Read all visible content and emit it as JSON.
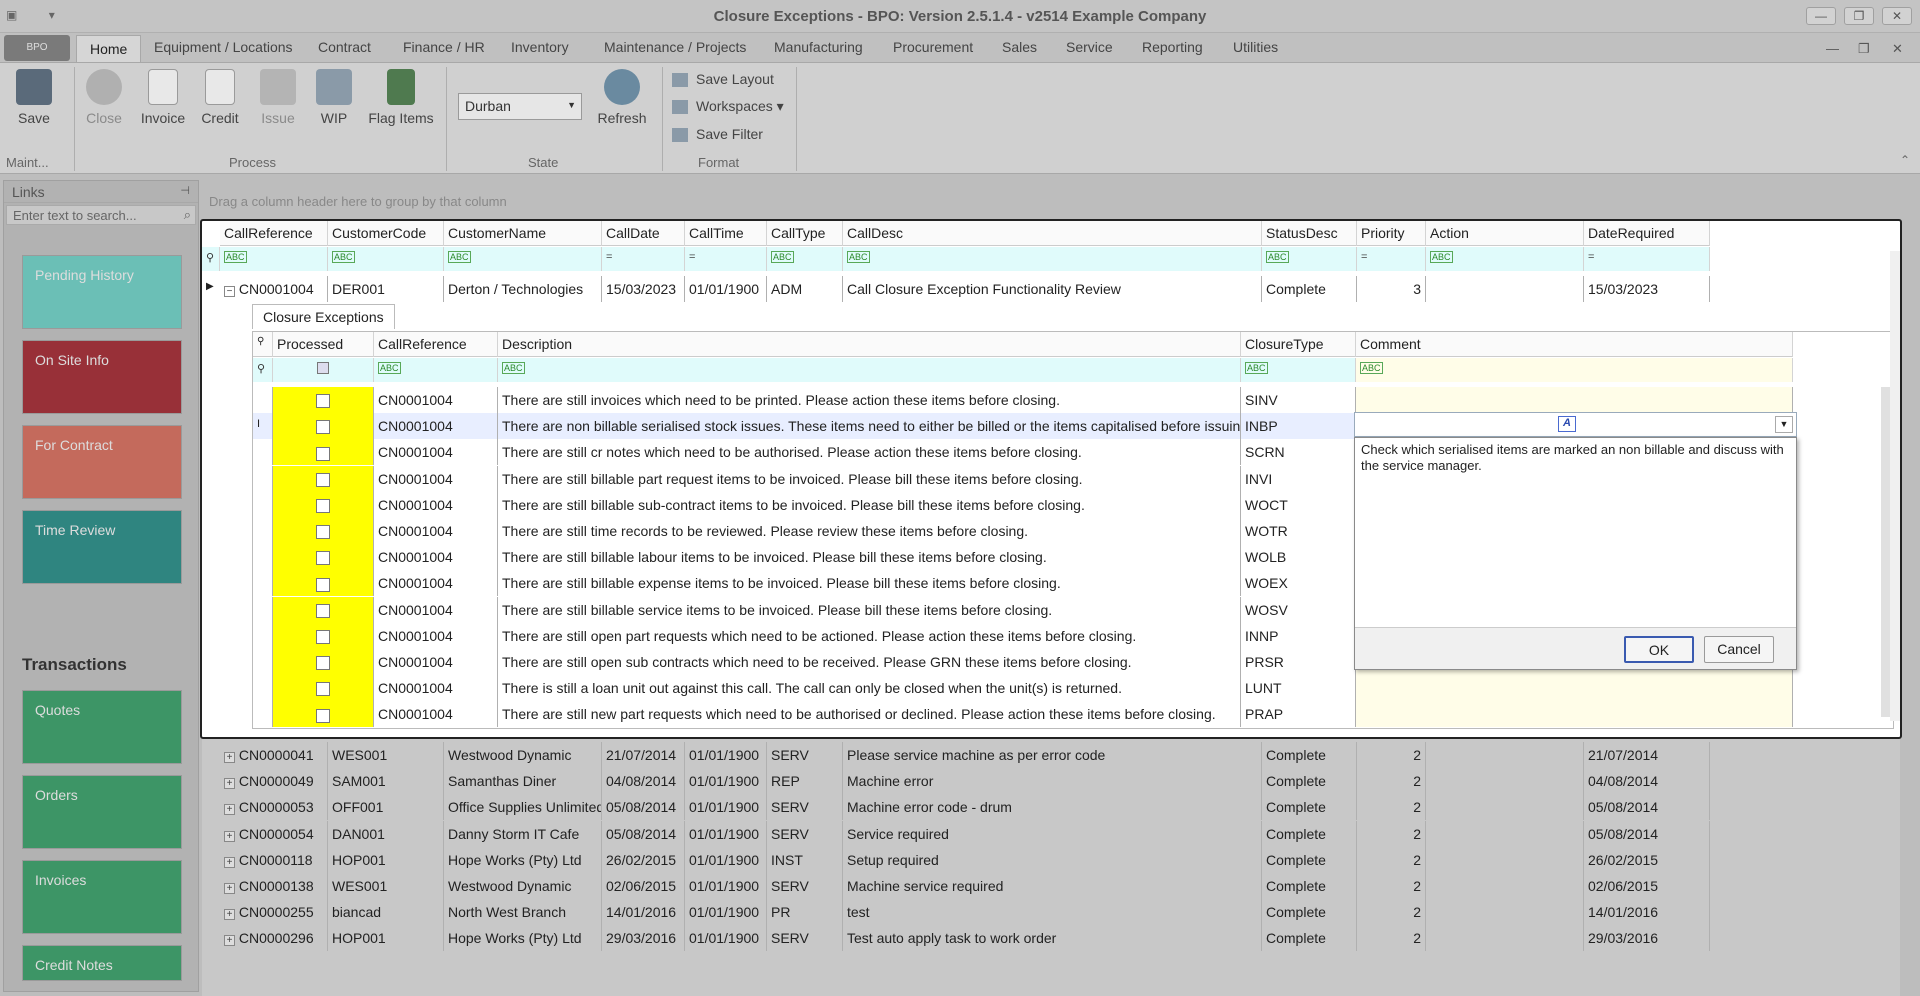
{
  "window": {
    "title": "Closure Exceptions - BPO: Version 2.5.1.4 - v2514 Example Company",
    "minimize": "—",
    "restore": "❐",
    "close": "✕"
  },
  "app_button": "BPO",
  "quick_access": {
    "icon1": "▣",
    "icon2": "▾"
  },
  "tabs": [
    "Home",
    "Equipment / Locations",
    "Contract",
    "Finance / HR",
    "Inventory",
    "Maintenance / Projects",
    "Manufacturing",
    "Procurement",
    "Sales",
    "Service",
    "Reporting",
    "Utilities"
  ],
  "ribbon": {
    "save": "Save",
    "close": "Close",
    "invoice": "Invoice",
    "credit": "Credit",
    "issue": "Issue",
    "wip": "WIP",
    "flag": "Flag Items",
    "location": "Durban",
    "refresh": "Refresh",
    "save_layout": "Save Layout",
    "workspaces": "Workspaces",
    "save_filter": "Save Filter",
    "groups": {
      "maint": "Maint...",
      "process": "Process",
      "state": "State",
      "format": "Format"
    }
  },
  "sidebar": {
    "header": "Links",
    "search_placeholder": "Enter text to search...",
    "tiles": [
      "Pending History",
      "On Site Info",
      "For Contract",
      "Time Review"
    ],
    "section": "Transactions",
    "transactions": [
      "Quotes",
      "Orders",
      "Invoices",
      "Credit Notes"
    ]
  },
  "groupby_hint": "Drag a column header here to group by that column",
  "main_columns": [
    "CallReference",
    "CustomerCode",
    "CustomerName",
    "CallDate",
    "CallTime",
    "CallType",
    "CallDesc",
    "StatusDesc",
    "Priority",
    "Action",
    "DateRequired"
  ],
  "expanded_row": {
    "ref": "CN0001004",
    "code": "DER001",
    "name": "Derton / Technologies",
    "date": "15/03/2023",
    "time": "01/01/1900",
    "type": "ADM",
    "desc": "Call Closure Exception Functionality Review",
    "status": "Complete",
    "priority": "3",
    "action": "",
    "required": "15/03/2023"
  },
  "detail_tab": "Closure Exceptions",
  "sub_columns": [
    "Processed",
    "CallReference",
    "Description",
    "ClosureType",
    "Comment"
  ],
  "exceptions": [
    {
      "ref": "CN0001004",
      "desc": "There are still invoices which need to be printed. Please action these items before closing.",
      "type": "SINV"
    },
    {
      "ref": "CN0001004",
      "desc": "There are non billable serialised stock issues. These items need to either be billed or the items capitalised before issuing.",
      "type": "INBP"
    },
    {
      "ref": "CN0001004",
      "desc": "There are still cr notes which need to be authorised. Please action these items before closing.",
      "type": "SCRN"
    },
    {
      "ref": "CN0001004",
      "desc": "There are still billable part request items to be invoiced. Please bill these items before closing.",
      "type": "INVI"
    },
    {
      "ref": "CN0001004",
      "desc": "There are still billable sub-contract items to be invoiced. Please bill these items before closing.",
      "type": "WOCT"
    },
    {
      "ref": "CN0001004",
      "desc": "There are still time records to be reviewed. Please review these items before closing.",
      "type": "WOTR"
    },
    {
      "ref": "CN0001004",
      "desc": "There are still billable labour items to be invoiced. Please bill these items before closing.",
      "type": "WOLB"
    },
    {
      "ref": "CN0001004",
      "desc": "There are still billable expense items to be invoiced. Please bill these items before closing.",
      "type": "WOEX"
    },
    {
      "ref": "CN0001004",
      "desc": "There are still billable service items to be invoiced. Please bill these items before closing.",
      "type": "WOSV"
    },
    {
      "ref": "CN0001004",
      "desc": "There are still open part requests which need to be actioned. Please action these items before closing.",
      "type": "INNP"
    },
    {
      "ref": "CN0001004",
      "desc": "There are still open sub contracts which need to be received. Please GRN these items before closing.",
      "type": "PRSR"
    },
    {
      "ref": "CN0001004",
      "desc": "There is still a loan unit out against this call. The call can only be closed when the unit(s) is returned.",
      "type": "LUNT"
    },
    {
      "ref": "CN0001004",
      "desc": "There are still new part requests which need to be authorised or declined. Please action these items before closing.",
      "type": "PRAP"
    }
  ],
  "comment_popup": {
    "text": "Check which serialised items are marked an non billable and discuss with the service manager.",
    "ok": "OK",
    "cancel": "Cancel"
  },
  "other_calls": [
    {
      "ref": "CN0000041",
      "code": "WES001",
      "name": "Westwood Dynamic",
      "date": "21/07/2014",
      "time": "01/01/1900",
      "type": "SERV",
      "desc": "Please service machine as per error code",
      "status": "Complete",
      "priority": "2",
      "required": "21/07/2014"
    },
    {
      "ref": "CN0000049",
      "code": "SAM001",
      "name": "Samanthas Diner",
      "date": "04/08/2014",
      "time": "01/01/1900",
      "type": "REP",
      "desc": "Machine error",
      "status": "Complete",
      "priority": "2",
      "required": "04/08/2014"
    },
    {
      "ref": "CN0000053",
      "code": "OFF001",
      "name": "Office Supplies Unlimited",
      "date": "05/08/2014",
      "time": "01/01/1900",
      "type": "SERV",
      "desc": "Machine error code - drum",
      "status": "Complete",
      "priority": "2",
      "required": "05/08/2014"
    },
    {
      "ref": "CN0000054",
      "code": "DAN001",
      "name": "Danny Storm IT Cafe",
      "date": "05/08/2014",
      "time": "01/01/1900",
      "type": "SERV",
      "desc": "Service required",
      "status": "Complete",
      "priority": "2",
      "required": "05/08/2014"
    },
    {
      "ref": "CN0000118",
      "code": "HOP001",
      "name": "Hope Works (Pty) Ltd",
      "date": "26/02/2015",
      "time": "01/01/1900",
      "type": "INST",
      "desc": "Setup required",
      "status": "Complete",
      "priority": "2",
      "required": "26/02/2015"
    },
    {
      "ref": "CN0000138",
      "code": "WES001",
      "name": "Westwood Dynamic",
      "date": "02/06/2015",
      "time": "01/01/1900",
      "type": "SERV",
      "desc": "Machine service required",
      "status": "Complete",
      "priority": "2",
      "required": "02/06/2015"
    },
    {
      "ref": "CN0000255",
      "code": "biancad",
      "name": "North West Branch",
      "date": "14/01/2016",
      "time": "01/01/1900",
      "type": "PR",
      "desc": "test",
      "status": "Complete",
      "priority": "2",
      "required": "14/01/2016"
    },
    {
      "ref": "CN0000296",
      "code": "HOP001",
      "name": "Hope Works (Pty) Ltd",
      "date": "29/03/2016",
      "time": "01/01/1900",
      "type": "SERV",
      "desc": "Test auto apply task to work order",
      "status": "Complete",
      "priority": "2",
      "required": "29/03/2016"
    }
  ],
  "colors": {
    "processed_bg": "#ffff00",
    "filter_bg": "#e0fbfb",
    "tile_pending": "#6ec8c0",
    "tile_onsite": "#a0333c",
    "tile_contract": "#d06a5e",
    "tile_time": "#2e8a86",
    "tile_tx": "#3e9a68"
  }
}
